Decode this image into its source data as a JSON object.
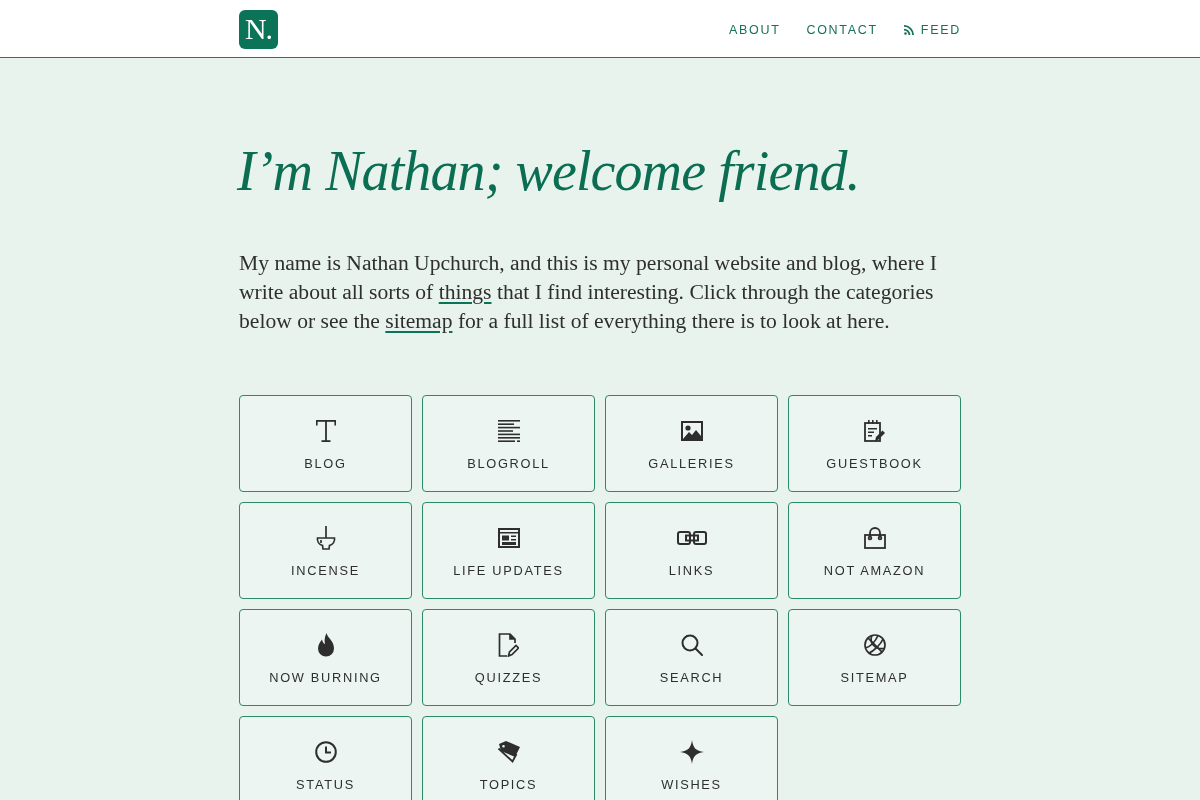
{
  "header": {
    "logo": "N.",
    "nav": [
      {
        "label": "ABOUT",
        "kind": "link"
      },
      {
        "label": "CONTACT",
        "kind": "link"
      },
      {
        "label": "FEED",
        "kind": "feed"
      }
    ]
  },
  "hero": {
    "title": "I’m Nathan; welcome friend.",
    "intro": [
      {
        "kind": "text",
        "text": "My name is Nathan Upchurch, and this is my personal website and blog, where I write about all sorts of "
      },
      {
        "kind": "link",
        "text": "things"
      },
      {
        "kind": "text",
        "text": " that I find interesting. Click through the categories below or see the "
      },
      {
        "kind": "link",
        "text": "sitemap"
      },
      {
        "kind": "text",
        "text": " for a full list of everything there is to look at here."
      }
    ]
  },
  "categories": [
    {
      "label": "BLOG"
    },
    {
      "label": "BLOGROLL"
    },
    {
      "label": "GALLERIES"
    },
    {
      "label": "GUESTBOOK"
    },
    {
      "label": "INCENSE"
    },
    {
      "label": "LIFE UPDATES"
    },
    {
      "label": "LINKS"
    },
    {
      "label": "NOT AMAZON"
    },
    {
      "label": "NOW BURNING"
    },
    {
      "label": "QUIZZES"
    },
    {
      "label": "SEARCH"
    },
    {
      "label": "SITEMAP"
    },
    {
      "label": "STATUS"
    },
    {
      "label": "TOPICS"
    },
    {
      "label": "WISHES"
    }
  ]
}
